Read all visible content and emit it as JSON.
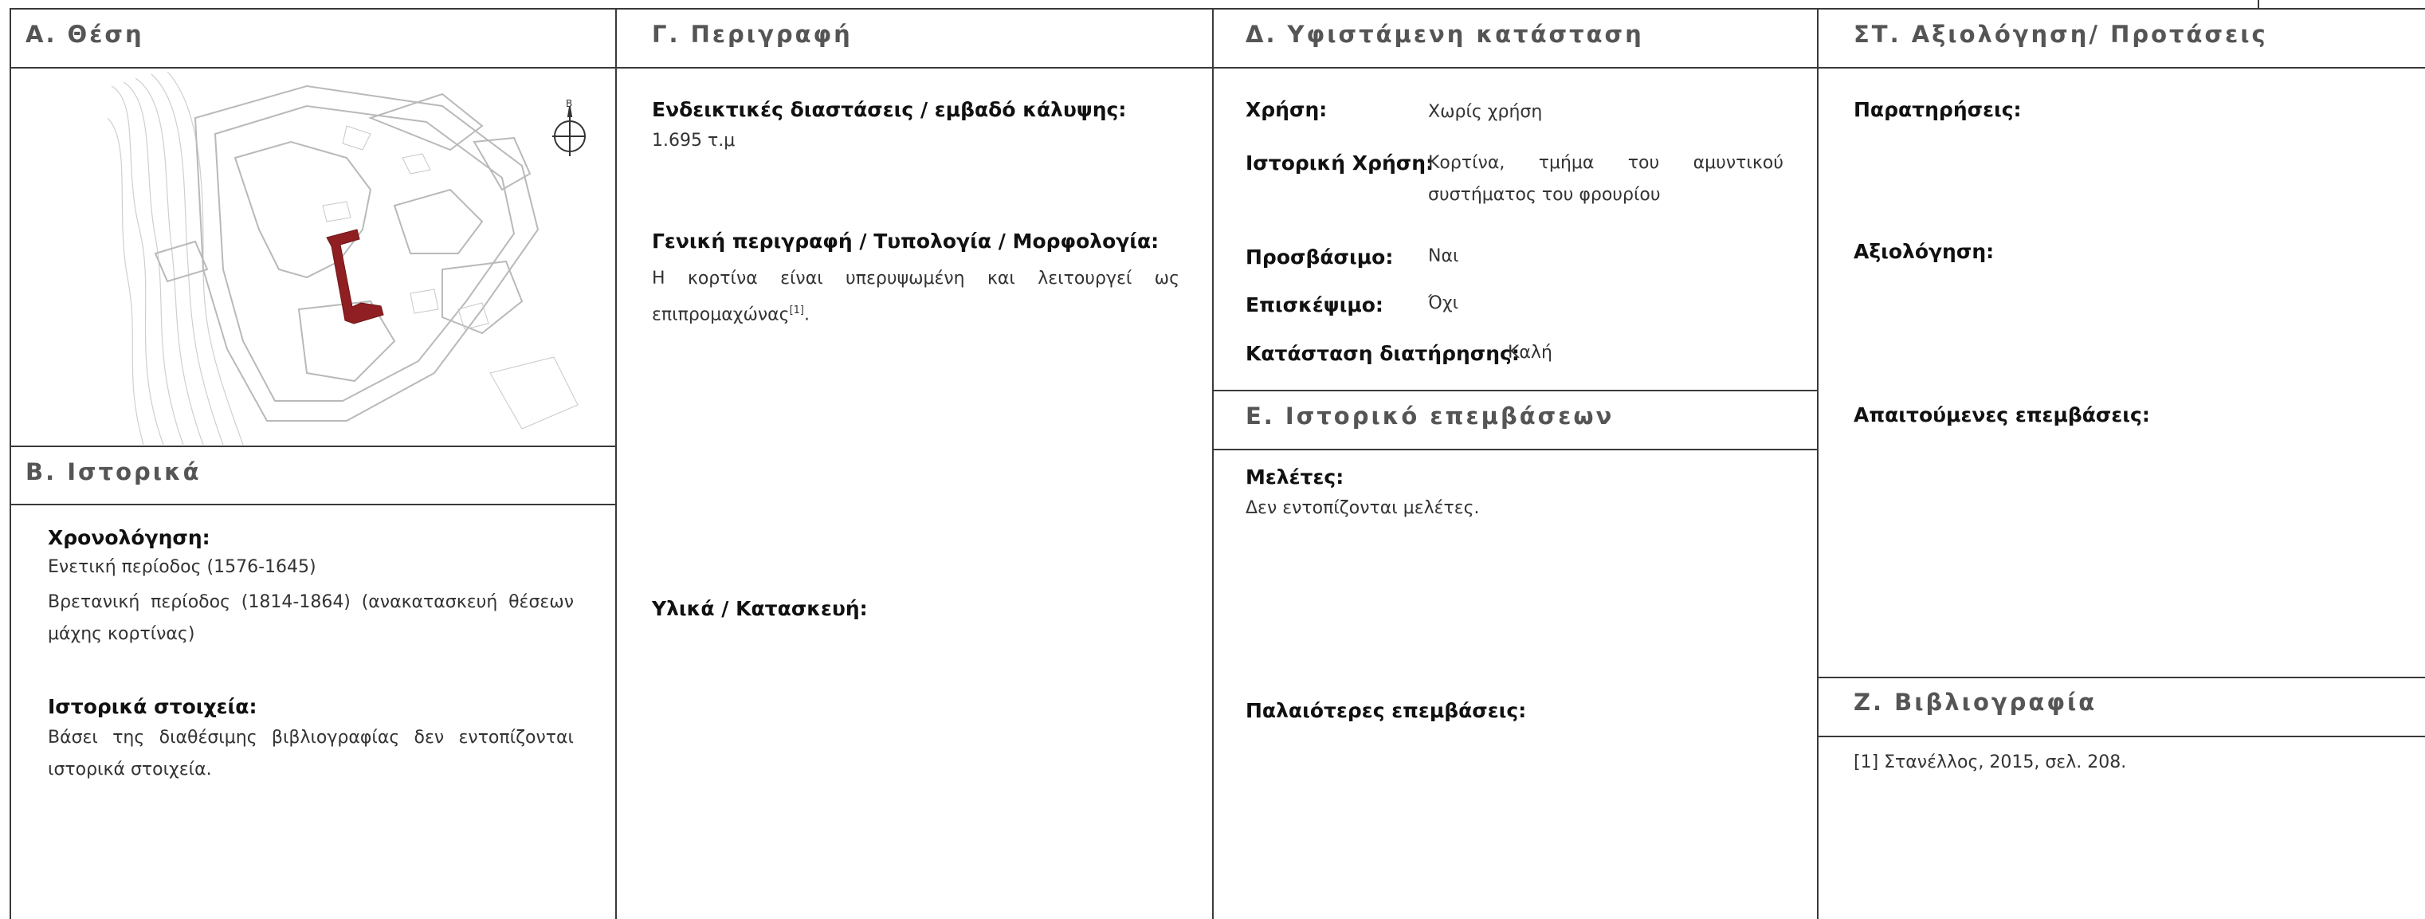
{
  "colors": {
    "rule": "#3a3a3a",
    "heading": "#555555",
    "highlight": "#8f1f22"
  },
  "sections": {
    "a": {
      "title": "Α. Θέση",
      "north_label": "Β"
    },
    "b": {
      "title": "Β. Ιστορικά",
      "dating_label": "Χρονολόγηση:",
      "dating_lines": [
        "Ενετική περίοδος (1576-1645)",
        "Βρετανική περίοδος (1814-1864) (ανακατασκευή θέσεων μάχης κορτίνας)"
      ],
      "facts_label": "Ιστορικά στοιχεία:",
      "facts_text": "Βάσει της διαθέσιμης βιβλιογραφίας δεν εντοπίζονται ιστορικά στοιχεία."
    },
    "c": {
      "title": "Γ. Περιγραφή",
      "dims_label": "Ενδεικτικές διαστάσεις / εμβαδό κάλυψης:",
      "dims_value": "1.695 τ.μ",
      "general_label": "Γενική περιγραφή / Τυπολογία / Μορφολογία:",
      "general_text": "Η κορτίνα είναι υπερυψωμένη και λειτουργεί ως επιπρομαχώνας",
      "general_ref": "[1]",
      "general_end": ".",
      "materials_label": "Υλικά / Κατασκευή:"
    },
    "d": {
      "title": "Δ. Υφιστάμενη κατάσταση",
      "use_label": "Χρήση:",
      "use_value": "Χωρίς χρήση",
      "hist_use_label": "Ιστορική Χρήση:",
      "hist_use_value": "Κορτίνα, τμήμα του αμυντικού συστήματος του φρουρίου",
      "access_label": "Προσβάσιμο:",
      "access_value": "Ναι",
      "visit_label": "Επισκέψιμο:",
      "visit_value": "Όχι",
      "condition_label": "Κατάσταση διατήρησης:",
      "condition_value": "Καλή"
    },
    "e": {
      "title": "Ε. Ιστορικό επεμβάσεων",
      "studies_label": "Μελέτες:",
      "studies_value": "Δεν εντοπίζονται μελέτες.",
      "past_label": "Παλαιότερες επεμβάσεις:"
    },
    "st": {
      "title": "ΣΤ. Αξιολόγηση/ Προτάσεις",
      "remarks_label": "Παρατηρήσεις:",
      "evaluation_label": "Αξιολόγηση:",
      "required_label": "Απαιτούμενες επεμβάσεις:"
    },
    "z": {
      "title": "Ζ. Βιβλιογραφία",
      "refs": [
        "[1] Στανέλλος, 2015, σελ. 208."
      ]
    }
  }
}
